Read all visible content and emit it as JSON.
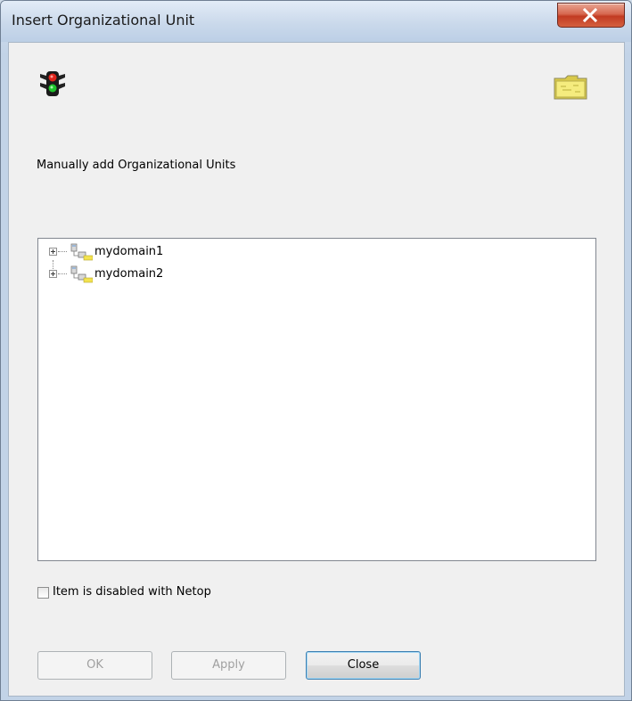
{
  "window": {
    "title": "Insert Organizational Unit",
    "close_icon": "close-icon"
  },
  "header": {
    "left_icon": "traffic-light-icon",
    "right_icon": "folder-icon"
  },
  "description": "Manually add Organizational Units",
  "tree": {
    "items": [
      {
        "label": "mydomain1",
        "icon": "domain-icon",
        "expanded": false
      },
      {
        "label": "mydomain2",
        "icon": "domain-icon",
        "expanded": false
      }
    ]
  },
  "checkbox": {
    "label": "Item is disabled with Netop",
    "checked": false
  },
  "buttons": {
    "ok": "OK",
    "apply": "Apply",
    "close": "Close"
  },
  "colors": {
    "title_bar": "#c9d8ea",
    "close_button": "#c23b22",
    "client_bg": "#f0f0f0",
    "folder": "#f2e46b"
  }
}
